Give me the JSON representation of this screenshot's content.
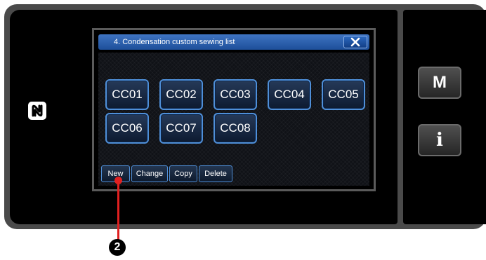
{
  "dialog": {
    "title": "4.   Condensation custom sewing list",
    "close_icon": "close-x-icon"
  },
  "patterns": [
    "CC01",
    "CC02",
    "CC03",
    "CC04",
    "CC05",
    "CC06",
    "CC07",
    "CC08"
  ],
  "actions": {
    "new_label": "New",
    "change_label": "Change",
    "copy_label": "Copy",
    "delete_label": "Delete"
  },
  "side": {
    "mode_label": "M",
    "info_label": "i",
    "nfc_icon": "nfc-icon"
  },
  "callout": {
    "number": "2"
  }
}
